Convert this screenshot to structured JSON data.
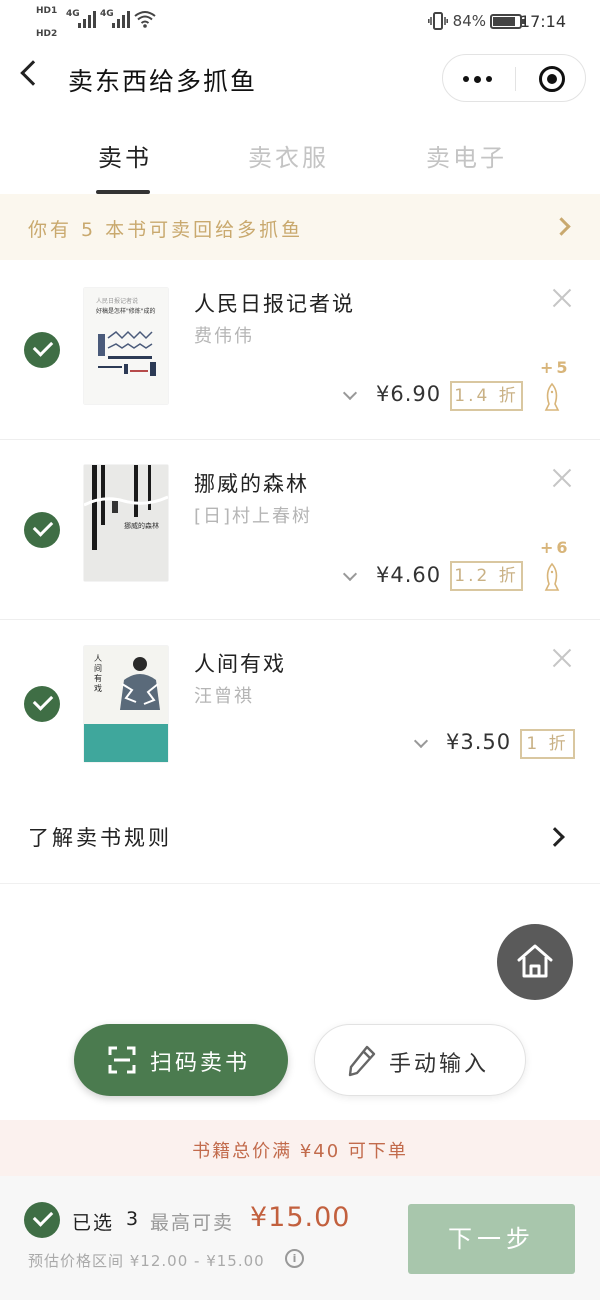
{
  "status_bar": {
    "left_badges": [
      "HD1",
      "HD2"
    ],
    "network_1": "4G",
    "network_2": "4G",
    "battery_percent": "84%",
    "battery_level": 0.84,
    "time": "17:14"
  },
  "navbar": {
    "title": "卖东西给多抓鱼"
  },
  "tabs": [
    {
      "label": "卖书",
      "active": true
    },
    {
      "label": "卖衣服",
      "active": false
    },
    {
      "label": "卖电子",
      "active": false
    }
  ],
  "notice": {
    "text": "你有 5 本书可卖回给多抓鱼"
  },
  "books": [
    {
      "title": "人民日报记者说",
      "author": "费伟伟",
      "price": "¥6.90",
      "discount": "1.4 折",
      "bonus": "+5",
      "cover_line1": "人民日报记者说",
      "cover_line2": "好稿是怎样\"修炼\"成的"
    },
    {
      "title": "挪威的森林",
      "author": "[日]村上春树",
      "price": "¥4.60",
      "discount": "1.2 折",
      "bonus": "+6",
      "cover_line1": "挪威的森林"
    },
    {
      "title": "人间有戏",
      "author": "汪曾祺",
      "price": "¥3.50",
      "discount": "1 折",
      "cover_line1": "人间有戏"
    }
  ],
  "rules": {
    "label": "了解卖书规则"
  },
  "actions": {
    "scan_label": "扫码卖书",
    "manual_label": "手动输入"
  },
  "min_order": {
    "text": "书籍总价满 ¥40 可下单"
  },
  "bottom_bar": {
    "selected_label": "已选",
    "selected_count": "3",
    "max_label": "最高可卖",
    "max_amount": "¥15.00",
    "range_text": "预估价格区间 ¥12.00 - ¥15.00",
    "info_glyph": "i",
    "next_label": "下一步"
  },
  "colors": {
    "brand_green": "#4b7b4f",
    "check_green": "#3f6e45",
    "gold": "#c9a96e",
    "price_red": "#c2603e",
    "next_disabled": "#a8c6ac"
  },
  "icons": [
    "back-icon",
    "more-dots-icon",
    "target-icon",
    "chevron-right-icon",
    "check-icon",
    "close-icon",
    "chevron-down-icon",
    "fish-icon",
    "home-icon",
    "scan-icon",
    "pencil-icon",
    "info-icon"
  ]
}
